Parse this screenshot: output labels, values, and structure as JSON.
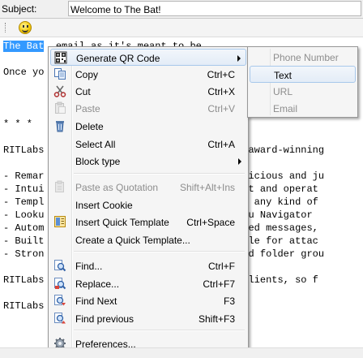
{
  "subject": {
    "label": "Subject:",
    "value": "Welcome to The Bat!"
  },
  "editor": {
    "lines": [
      {
        "pre": "",
        "selected": "The Bat",
        "post": "  email as it's meant to be"
      },
      {
        "pre": "Once yo",
        "selected": "",
        "post": ""
      },
      {
        "pre": "* * *",
        "selected": "",
        "post": ""
      },
      {
        "pre": "RITLabs",
        "selected": "",
        "post": "                              at!, award-winning"
      },
      {
        "pre": "- Remar",
        "selected": "",
        "post": "                              n malicious and ju"
      },
      {
        "pre": "- Intui",
        "selected": "",
        "post": "                              layout and operat"
      },
      {
        "pre": "- Templ",
        "selected": "",
        "post": "                              e for any kind of"
      },
      {
        "pre": "- Looku",
        "selected": "",
        "post": "                              n Menu Navigator"
      },
      {
        "pre": "- Autom",
        "selected": "",
        "post": "                              rwarded messages,"
      },
      {
        "pre": "- Built",
        "selected": "",
        "post": "                              nerable for attac"
      },
      {
        "pre": "- Stron",
        "selected": "",
        "post": "                              rs and folder grou"
      },
      {
        "pre": "RITLabs",
        "selected": "",
        "post": "                              the clients, so f"
      },
      {
        "pre": "RITLabs",
        "selected": "",
        "post": "                              ay"
      }
    ]
  },
  "menu": {
    "items": [
      {
        "label": "Generate QR Code",
        "shortcut": "",
        "submenu": true,
        "disabled": false,
        "highlight": true,
        "icon": "qr-code-icon"
      },
      {
        "label": "Copy",
        "shortcut": "Ctrl+C",
        "submenu": false,
        "disabled": false,
        "highlight": false,
        "icon": "copy-icon"
      },
      {
        "label": "Cut",
        "shortcut": "Ctrl+X",
        "submenu": false,
        "disabled": false,
        "highlight": false,
        "icon": "scissors-icon"
      },
      {
        "label": "Paste",
        "shortcut": "Ctrl+V",
        "submenu": false,
        "disabled": true,
        "highlight": false,
        "icon": "paste-icon"
      },
      {
        "label": "Delete",
        "shortcut": "",
        "submenu": false,
        "disabled": false,
        "highlight": false,
        "icon": "trash-icon"
      },
      {
        "label": "Select All",
        "shortcut": "Ctrl+A",
        "submenu": false,
        "disabled": false,
        "highlight": false,
        "icon": ""
      },
      {
        "label": "Block type",
        "shortcut": "",
        "submenu": true,
        "disabled": false,
        "highlight": false,
        "icon": ""
      },
      {
        "label": "Paste as Quotation",
        "shortcut": "Shift+Alt+Ins",
        "submenu": false,
        "disabled": true,
        "highlight": false,
        "icon": "paste-quote-icon"
      },
      {
        "label": "Insert Cookie",
        "shortcut": "",
        "submenu": false,
        "disabled": false,
        "highlight": false,
        "icon": ""
      },
      {
        "label": "Insert Quick Template",
        "shortcut": "Ctrl+Space",
        "submenu": false,
        "disabled": false,
        "highlight": false,
        "icon": "template-icon"
      },
      {
        "label": "Create a Quick Template...",
        "shortcut": "",
        "submenu": false,
        "disabled": false,
        "highlight": false,
        "icon": ""
      },
      {
        "label": "Find...",
        "shortcut": "Ctrl+F",
        "submenu": false,
        "disabled": false,
        "highlight": false,
        "icon": "find-icon"
      },
      {
        "label": "Replace...",
        "shortcut": "Ctrl+F7",
        "submenu": false,
        "disabled": false,
        "highlight": false,
        "icon": "replace-icon"
      },
      {
        "label": "Find Next",
        "shortcut": "F3",
        "submenu": false,
        "disabled": false,
        "highlight": false,
        "icon": "find-next-icon"
      },
      {
        "label": "Find previous",
        "shortcut": "Shift+F3",
        "submenu": false,
        "disabled": false,
        "highlight": false,
        "icon": "find-previous-icon"
      },
      {
        "label": "Preferences...",
        "shortcut": "",
        "submenu": false,
        "disabled": false,
        "highlight": false,
        "icon": "gear-icon"
      }
    ]
  },
  "submenu": {
    "items": [
      {
        "label": "Phone Number",
        "disabled": true,
        "highlight": false
      },
      {
        "label": "Text",
        "disabled": false,
        "highlight": true
      },
      {
        "label": "URL",
        "disabled": true,
        "highlight": false
      },
      {
        "label": "Email",
        "disabled": true,
        "highlight": false
      }
    ]
  }
}
